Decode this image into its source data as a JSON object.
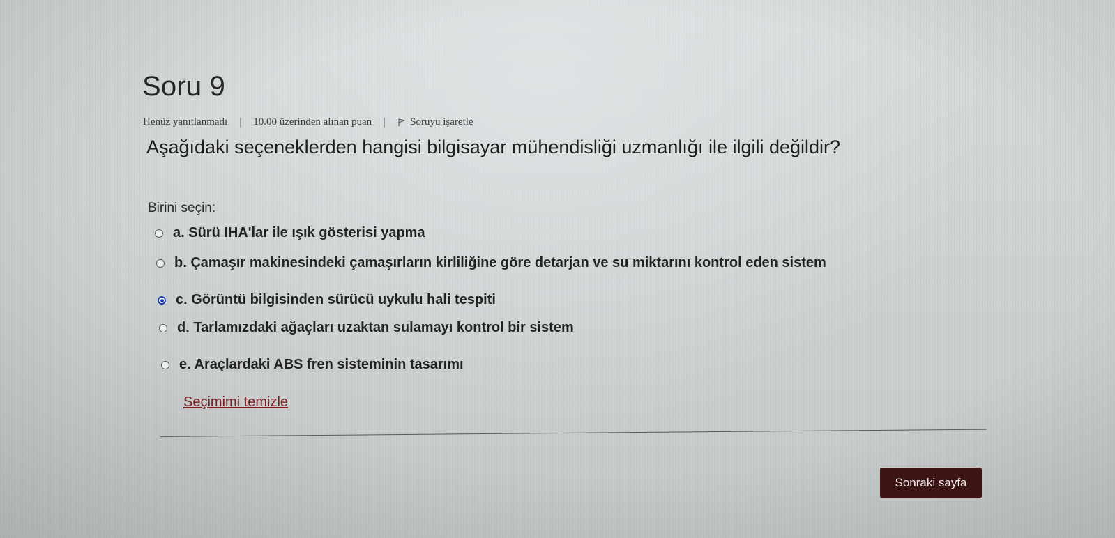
{
  "question": {
    "title": "Soru 9",
    "status": "Henüz yanıtlanmadı",
    "points": "10.00 üzerinden alınan puan",
    "flag_label": "Soruyu işaretle",
    "text": "Aşağıdaki seçeneklerden hangisi bilgisayar mühendisliği uzmanlığı ile ilgili değildir?",
    "prompt": "Birini seçin:",
    "options": [
      {
        "label": "a. Sürü IHA'lar ile ışık gösterisi yapma",
        "selected": false
      },
      {
        "label": "b. Çamaşır makinesindeki çamaşırların kirliliğine göre detarjan ve su miktarını kontrol eden sistem",
        "selected": false
      },
      {
        "label": "c. Görüntü bilgisinden sürücü uykulu hali tespiti",
        "selected": true
      },
      {
        "label": "d. Tarlamızdaki ağaçları uzaktan sulamayı kontrol bir sistem",
        "selected": false
      },
      {
        "label": "e. Araçlardaki ABS fren sisteminin tasarımı",
        "selected": false
      }
    ],
    "clear_label": "Seçimimi temizle"
  },
  "navigation": {
    "next_label": "Sonraki sayfa"
  },
  "colors": {
    "next_button_bg": "#3d1515",
    "clear_link": "#7a1f1f",
    "radio_selected": "#1f3fb0"
  },
  "icons": {
    "flag": "flag-icon"
  }
}
